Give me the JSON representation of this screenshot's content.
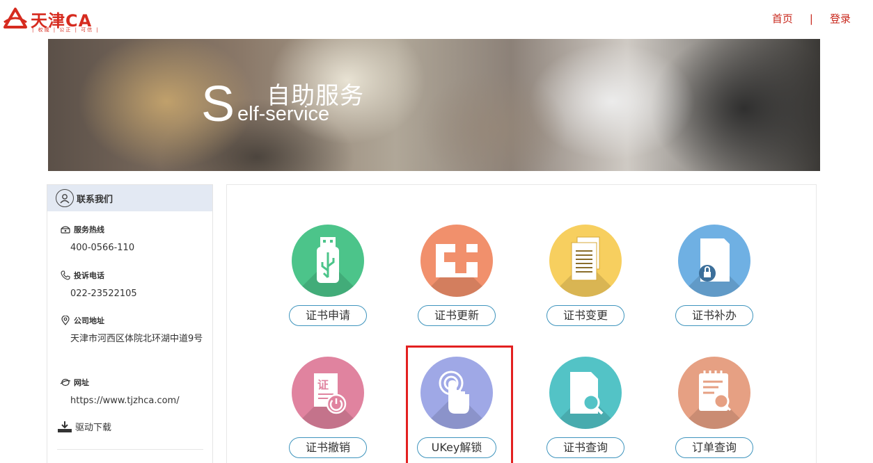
{
  "header": {
    "logo_name": "天津CA",
    "logo_tagline": "| 权威 | 公正 | 可信 |",
    "nav": [
      {
        "label": "首页"
      },
      {
        "label": "登录"
      }
    ],
    "nav_separator": "|"
  },
  "banner": {
    "big_letter": "S",
    "title_cn": "自助服务",
    "title_en": "elf-service"
  },
  "sidebar": {
    "title": "联系我们",
    "items": [
      {
        "label": "服务热线",
        "value": "400-0566-110",
        "icon": "phone-icon"
      },
      {
        "label": "投诉电话",
        "value": "022-23522105",
        "icon": "handset-icon"
      },
      {
        "label": "公司地址",
        "value": "天津市河西区体院北环湖中道9号",
        "icon": "location-icon"
      },
      {
        "label": "网址",
        "value": "https://www.tjzhca.com/",
        "icon": "globe-icon"
      }
    ],
    "download_label": "驱动下载"
  },
  "services": [
    {
      "label": "证书申请",
      "color": "#4cc48a",
      "icon": "usb-icon"
    },
    {
      "label": "证书更新",
      "color": "#f1906c",
      "icon": "medical-cross-icon"
    },
    {
      "label": "证书变更",
      "color": "#f7cf5f",
      "icon": "documents-icon"
    },
    {
      "label": "证书补办",
      "color": "#6fb0e3",
      "icon": "locked-document-icon"
    },
    {
      "label": "证书撤销",
      "color": "#e0839f",
      "icon": "certificate-power-icon"
    },
    {
      "label": "UKey解锁",
      "color": "#9fa8e6",
      "icon": "touch-icon"
    },
    {
      "label": "证书查询",
      "color": "#53c3c6",
      "icon": "document-search-icon"
    },
    {
      "label": "订单查询",
      "color": "#e6a083",
      "icon": "order-search-icon"
    }
  ],
  "colors": {
    "brand_red": "#d62b1f",
    "pill_border": "#3e94bd",
    "highlight": "#e32020"
  }
}
